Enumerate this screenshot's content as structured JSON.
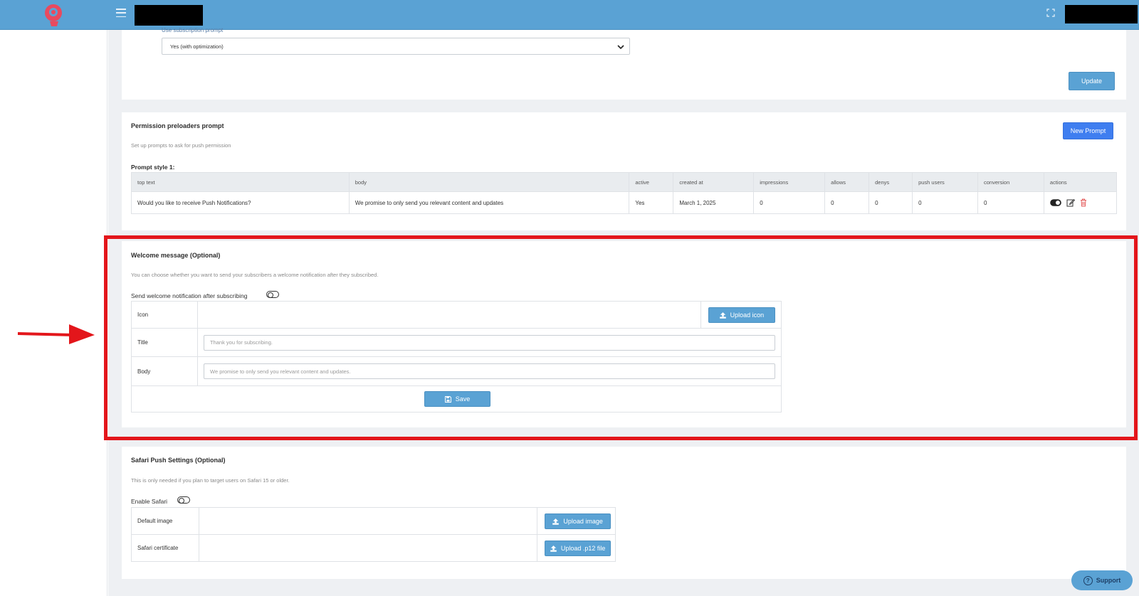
{
  "colors": {
    "topbar": "#5aa2d4",
    "accent_button": "#5aa2d4",
    "new_prompt_button": "#3f7ef0",
    "highlight": "#e3161b",
    "delete_icon": "#e35b5b"
  },
  "topbar": {
    "logo_icon": "brand-head-logo",
    "menu_icon": "hamburger-icon",
    "fullscreen_icon": "fullscreen-icon"
  },
  "subscription": {
    "label_partial": "Use subscription prompt",
    "select_value": "Yes (with optimization)",
    "update_label": "Update"
  },
  "preloaders": {
    "title": "Permission preloaders prompt",
    "subtitle": "Set up prompts to ask for push permission",
    "new_prompt_label": "New Prompt",
    "style_label": "Prompt style 1:",
    "columns": [
      "top text",
      "body",
      "active",
      "created at",
      "impressions",
      "allows",
      "denys",
      "push users",
      "conversion",
      "actions"
    ],
    "rows": [
      [
        "Would you like to receive Push Notifications?",
        "We promise to only send you relevant content and updates",
        "Yes",
        "March 1, 2025",
        "0",
        "0",
        "0",
        "0",
        "0"
      ]
    ]
  },
  "welcome": {
    "title": "Welcome message (Optional)",
    "subtitle": "You can choose whether you want to send your subscribers a welcome notification after they subscribed.",
    "toggle_label": "Send welcome notification after subscribing",
    "icon_label": "Icon",
    "upload_icon_label": "Upload icon",
    "title_label": "Title",
    "title_placeholder": "Thank you for subscribing.",
    "body_label": "Body",
    "body_placeholder": "We promise to only send you relevant content and updates.",
    "save_label": "Save"
  },
  "safari": {
    "title": "Safari Push Settings (Optional)",
    "subtitle": "This is only needed if you plan to target users on Safari 15 or older.",
    "toggle_label": "Enable Safari",
    "default_image_label": "Default image",
    "upload_image_label": "Upload image",
    "certificate_label": "Safari certificate",
    "upload_p12_label": "Upload .p12 file"
  },
  "support": {
    "label": "Support"
  }
}
